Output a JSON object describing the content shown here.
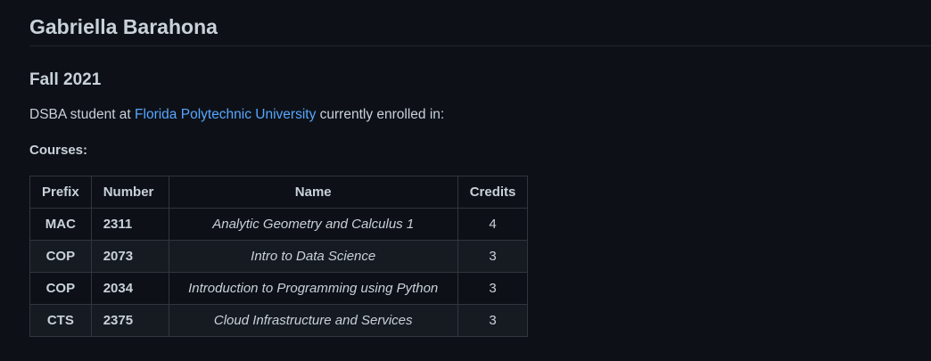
{
  "profile": {
    "name": "Gabriella Barahona"
  },
  "term": {
    "heading": "Fall 2021",
    "intro_before": "DSBA student at ",
    "university_link": "Florida Polytechnic University",
    "intro_after": " currently enrolled in:"
  },
  "courses": {
    "label": "Courses:",
    "headers": {
      "prefix": "Prefix",
      "number": "Number",
      "name": "Name",
      "credits": "Credits"
    },
    "rows": [
      {
        "prefix": "MAC",
        "number": "2311",
        "name": "Analytic Geometry and Calculus 1",
        "credits": "4"
      },
      {
        "prefix": "COP",
        "number": "2073",
        "name": "Intro to Data Science",
        "credits": "3"
      },
      {
        "prefix": "COP",
        "number": "2034",
        "name": "Introduction to Programming using Python",
        "credits": "3"
      },
      {
        "prefix": "CTS",
        "number": "2375",
        "name": "Cloud Infrastructure and Services",
        "credits": "3"
      }
    ]
  }
}
